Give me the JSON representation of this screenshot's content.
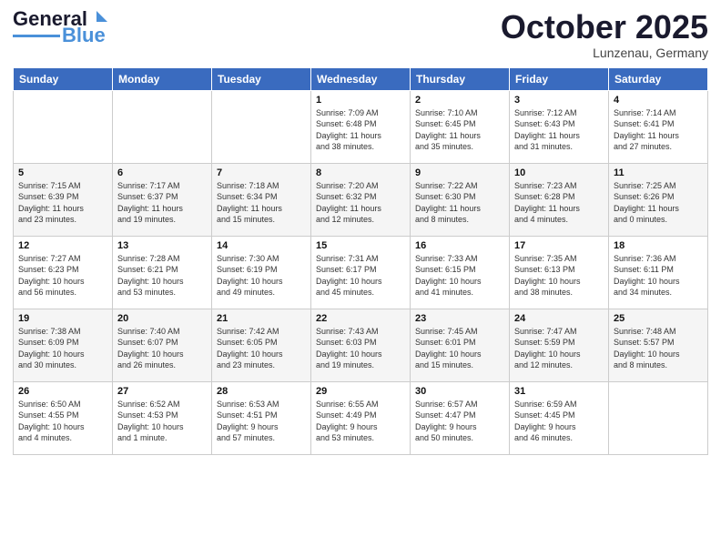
{
  "header": {
    "logo_line1": "General",
    "logo_line2": "Blue",
    "month": "October 2025",
    "location": "Lunzenau, Germany"
  },
  "weekdays": [
    "Sunday",
    "Monday",
    "Tuesday",
    "Wednesday",
    "Thursday",
    "Friday",
    "Saturday"
  ],
  "weeks": [
    [
      {
        "day": "",
        "info": ""
      },
      {
        "day": "",
        "info": ""
      },
      {
        "day": "",
        "info": ""
      },
      {
        "day": "1",
        "info": "Sunrise: 7:09 AM\nSunset: 6:48 PM\nDaylight: 11 hours\nand 38 minutes."
      },
      {
        "day": "2",
        "info": "Sunrise: 7:10 AM\nSunset: 6:45 PM\nDaylight: 11 hours\nand 35 minutes."
      },
      {
        "day": "3",
        "info": "Sunrise: 7:12 AM\nSunset: 6:43 PM\nDaylight: 11 hours\nand 31 minutes."
      },
      {
        "day": "4",
        "info": "Sunrise: 7:14 AM\nSunset: 6:41 PM\nDaylight: 11 hours\nand 27 minutes."
      }
    ],
    [
      {
        "day": "5",
        "info": "Sunrise: 7:15 AM\nSunset: 6:39 PM\nDaylight: 11 hours\nand 23 minutes."
      },
      {
        "day": "6",
        "info": "Sunrise: 7:17 AM\nSunset: 6:37 PM\nDaylight: 11 hours\nand 19 minutes."
      },
      {
        "day": "7",
        "info": "Sunrise: 7:18 AM\nSunset: 6:34 PM\nDaylight: 11 hours\nand 15 minutes."
      },
      {
        "day": "8",
        "info": "Sunrise: 7:20 AM\nSunset: 6:32 PM\nDaylight: 11 hours\nand 12 minutes."
      },
      {
        "day": "9",
        "info": "Sunrise: 7:22 AM\nSunset: 6:30 PM\nDaylight: 11 hours\nand 8 minutes."
      },
      {
        "day": "10",
        "info": "Sunrise: 7:23 AM\nSunset: 6:28 PM\nDaylight: 11 hours\nand 4 minutes."
      },
      {
        "day": "11",
        "info": "Sunrise: 7:25 AM\nSunset: 6:26 PM\nDaylight: 11 hours\nand 0 minutes."
      }
    ],
    [
      {
        "day": "12",
        "info": "Sunrise: 7:27 AM\nSunset: 6:23 PM\nDaylight: 10 hours\nand 56 minutes."
      },
      {
        "day": "13",
        "info": "Sunrise: 7:28 AM\nSunset: 6:21 PM\nDaylight: 10 hours\nand 53 minutes."
      },
      {
        "day": "14",
        "info": "Sunrise: 7:30 AM\nSunset: 6:19 PM\nDaylight: 10 hours\nand 49 minutes."
      },
      {
        "day": "15",
        "info": "Sunrise: 7:31 AM\nSunset: 6:17 PM\nDaylight: 10 hours\nand 45 minutes."
      },
      {
        "day": "16",
        "info": "Sunrise: 7:33 AM\nSunset: 6:15 PM\nDaylight: 10 hours\nand 41 minutes."
      },
      {
        "day": "17",
        "info": "Sunrise: 7:35 AM\nSunset: 6:13 PM\nDaylight: 10 hours\nand 38 minutes."
      },
      {
        "day": "18",
        "info": "Sunrise: 7:36 AM\nSunset: 6:11 PM\nDaylight: 10 hours\nand 34 minutes."
      }
    ],
    [
      {
        "day": "19",
        "info": "Sunrise: 7:38 AM\nSunset: 6:09 PM\nDaylight: 10 hours\nand 30 minutes."
      },
      {
        "day": "20",
        "info": "Sunrise: 7:40 AM\nSunset: 6:07 PM\nDaylight: 10 hours\nand 26 minutes."
      },
      {
        "day": "21",
        "info": "Sunrise: 7:42 AM\nSunset: 6:05 PM\nDaylight: 10 hours\nand 23 minutes."
      },
      {
        "day": "22",
        "info": "Sunrise: 7:43 AM\nSunset: 6:03 PM\nDaylight: 10 hours\nand 19 minutes."
      },
      {
        "day": "23",
        "info": "Sunrise: 7:45 AM\nSunset: 6:01 PM\nDaylight: 10 hours\nand 15 minutes."
      },
      {
        "day": "24",
        "info": "Sunrise: 7:47 AM\nSunset: 5:59 PM\nDaylight: 10 hours\nand 12 minutes."
      },
      {
        "day": "25",
        "info": "Sunrise: 7:48 AM\nSunset: 5:57 PM\nDaylight: 10 hours\nand 8 minutes."
      }
    ],
    [
      {
        "day": "26",
        "info": "Sunrise: 6:50 AM\nSunset: 4:55 PM\nDaylight: 10 hours\nand 4 minutes."
      },
      {
        "day": "27",
        "info": "Sunrise: 6:52 AM\nSunset: 4:53 PM\nDaylight: 10 hours\nand 1 minute."
      },
      {
        "day": "28",
        "info": "Sunrise: 6:53 AM\nSunset: 4:51 PM\nDaylight: 9 hours\nand 57 minutes."
      },
      {
        "day": "29",
        "info": "Sunrise: 6:55 AM\nSunset: 4:49 PM\nDaylight: 9 hours\nand 53 minutes."
      },
      {
        "day": "30",
        "info": "Sunrise: 6:57 AM\nSunset: 4:47 PM\nDaylight: 9 hours\nand 50 minutes."
      },
      {
        "day": "31",
        "info": "Sunrise: 6:59 AM\nSunset: 4:45 PM\nDaylight: 9 hours\nand 46 minutes."
      },
      {
        "day": "",
        "info": ""
      }
    ]
  ]
}
